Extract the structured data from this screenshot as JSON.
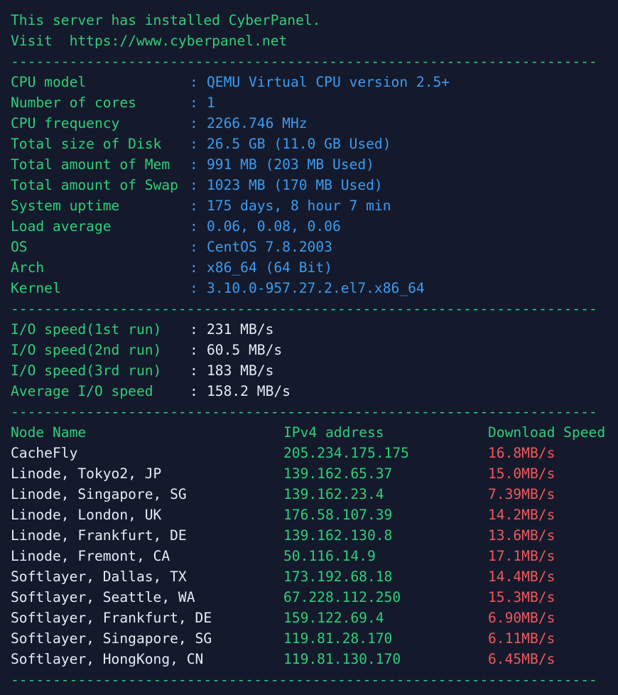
{
  "header": {
    "line1": "This server has installed CyberPanel.",
    "line2": "Visit  https://www.cyberpanel.net"
  },
  "separator": "----------------------------------------------------------------------",
  "system_info": [
    {
      "label": "CPU model",
      "value": "QEMU Virtual CPU version 2.5+"
    },
    {
      "label": "Number of cores",
      "value": "1"
    },
    {
      "label": "CPU frequency",
      "value": "2266.746 MHz"
    },
    {
      "label": "Total size of Disk",
      "value": "26.5 GB (11.0 GB Used)"
    },
    {
      "label": "Total amount of Mem",
      "value": "991 MB (203 MB Used)"
    },
    {
      "label": "Total amount of Swap",
      "value": "1023 MB (170 MB Used)"
    },
    {
      "label": "System uptime",
      "value": "175 days, 8 hour 7 min"
    },
    {
      "label": "Load average",
      "value": "0.06, 0.08, 0.06"
    },
    {
      "label": "OS",
      "value": "CentOS 7.8.2003"
    },
    {
      "label": "Arch",
      "value": "x86_64 (64 Bit)"
    },
    {
      "label": "Kernel",
      "value": "3.10.0-957.27.2.el7.x86_64"
    }
  ],
  "io_info": [
    {
      "label": "I/O speed(1st run)",
      "value": "231 MB/s"
    },
    {
      "label": "I/O speed(2nd run)",
      "value": "60.5 MB/s"
    },
    {
      "label": "I/O speed(3rd run)",
      "value": "183 MB/s"
    },
    {
      "label": "Average I/O speed",
      "value": "158.2 MB/s"
    }
  ],
  "colon": ":",
  "speed_table": {
    "headers": [
      "Node Name",
      "IPv4 address",
      "Download Speed"
    ],
    "rows": [
      {
        "node": "CacheFly",
        "ip": "205.234.175.175",
        "speed": "16.8MB/s"
      },
      {
        "node": "Linode, Tokyo2, JP",
        "ip": "139.162.65.37",
        "speed": "15.0MB/s"
      },
      {
        "node": "Linode, Singapore, SG",
        "ip": "139.162.23.4",
        "speed": "7.39MB/s"
      },
      {
        "node": "Linode, London, UK",
        "ip": "176.58.107.39",
        "speed": "14.2MB/s"
      },
      {
        "node": "Linode, Frankfurt, DE",
        "ip": "139.162.130.8",
        "speed": "13.6MB/s"
      },
      {
        "node": "Linode, Fremont, CA",
        "ip": "50.116.14.9",
        "speed": "17.1MB/s"
      },
      {
        "node": "Softlayer, Dallas, TX",
        "ip": "173.192.68.18",
        "speed": "14.4MB/s"
      },
      {
        "node": "Softlayer, Seattle, WA",
        "ip": "67.228.112.250",
        "speed": "15.3MB/s"
      },
      {
        "node": "Softlayer, Frankfurt, DE",
        "ip": "159.122.69.4",
        "speed": "6.90MB/s"
      },
      {
        "node": "Softlayer, Singapore, SG",
        "ip": "119.81.28.170",
        "speed": "6.11MB/s"
      },
      {
        "node": "Softlayer, HongKong, CN",
        "ip": "119.81.130.170",
        "speed": "6.45MB/s"
      }
    ]
  },
  "colors": {
    "background": "#141a2c",
    "label_green": "#2fcf78",
    "value_blue": "#3d9bf0",
    "text_white": "#e6ecf4",
    "speed_red": "#f0575c"
  }
}
